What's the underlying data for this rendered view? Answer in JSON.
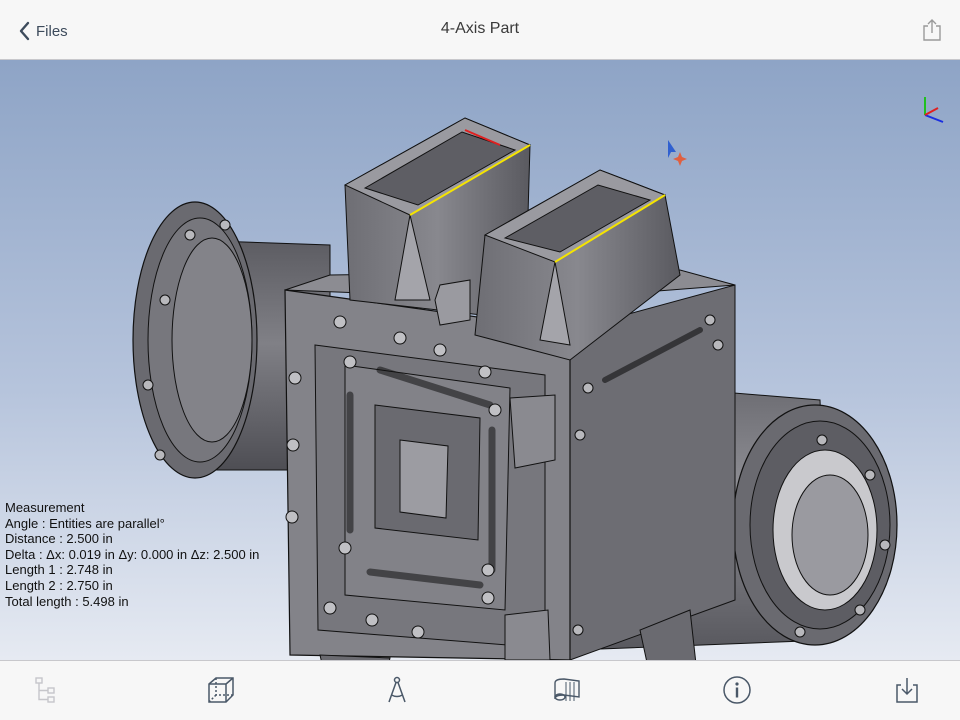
{
  "nav": {
    "back_label": "Files",
    "title": "4-Axis Part"
  },
  "icons": {
    "back": "chevron-left-icon",
    "share": "share-icon",
    "tree": "tree-icon",
    "view_cube": "view-cube-icon",
    "measure": "compass-icon",
    "section": "section-icon",
    "info": "info-icon",
    "download": "download-icon"
  },
  "colors": {
    "accent": "#3d4b5c",
    "edge_highlight": "#f5e400",
    "axis_x": "#1a2ee0",
    "axis_y": "#20c020",
    "axis_z": "#e02020"
  },
  "measurement": {
    "heading": "Measurement",
    "angle": "Angle : Entities are parallel°",
    "distance": "Distance :  2.500 in",
    "delta": "Delta : Δx: 0.019 in Δy: 0.000 in Δz: 2.500 in",
    "length1": "Length 1 :  2.748 in",
    "length2": "Length 2 :  2.750 in",
    "total": "Total length :  5.498 in"
  }
}
